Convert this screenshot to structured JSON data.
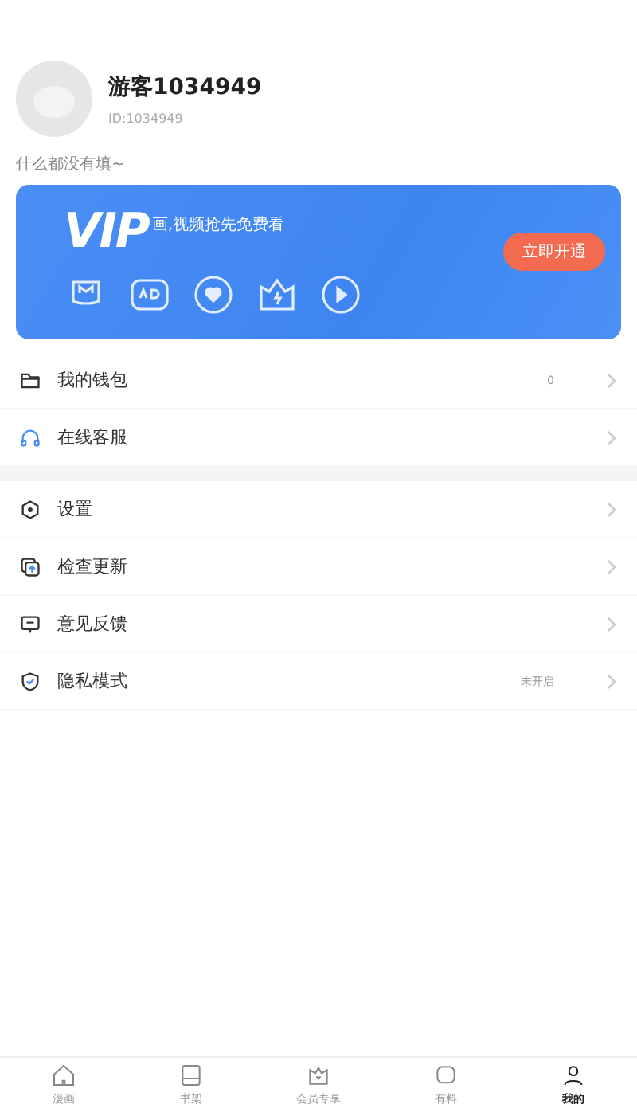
{
  "profile": {
    "name": "游客1034949",
    "id": "ID:1034949",
    "bio": "什么都没有填~"
  },
  "vip": {
    "logo": "VIP",
    "tagline": "画,视频抢先免费看",
    "button": "立即开通"
  },
  "menu_groups": [
    {
      "items": [
        {
          "kind": "wallet",
          "label": "我的钱包",
          "value": "0"
        },
        {
          "kind": "headset",
          "label": "在线客服"
        }
      ]
    },
    {
      "items": [
        {
          "kind": "settings",
          "label": "设置"
        },
        {
          "kind": "update",
          "label": "检查更新"
        },
        {
          "kind": "feedback",
          "label": "意见反馈"
        },
        {
          "kind": "shield",
          "label": "隐私模式",
          "value": "未开启"
        }
      ]
    }
  ],
  "tab_bar": [
    {
      "kind": "home",
      "label": "漫画",
      "selected": false
    },
    {
      "kind": "book",
      "label": "书架",
      "selected": false
    },
    {
      "kind": "vip",
      "label": "会员专享",
      "selected": false
    },
    {
      "kind": "chat",
      "label": "有料",
      "selected": false
    },
    {
      "kind": "user",
      "label": "我的",
      "selected": true
    }
  ]
}
